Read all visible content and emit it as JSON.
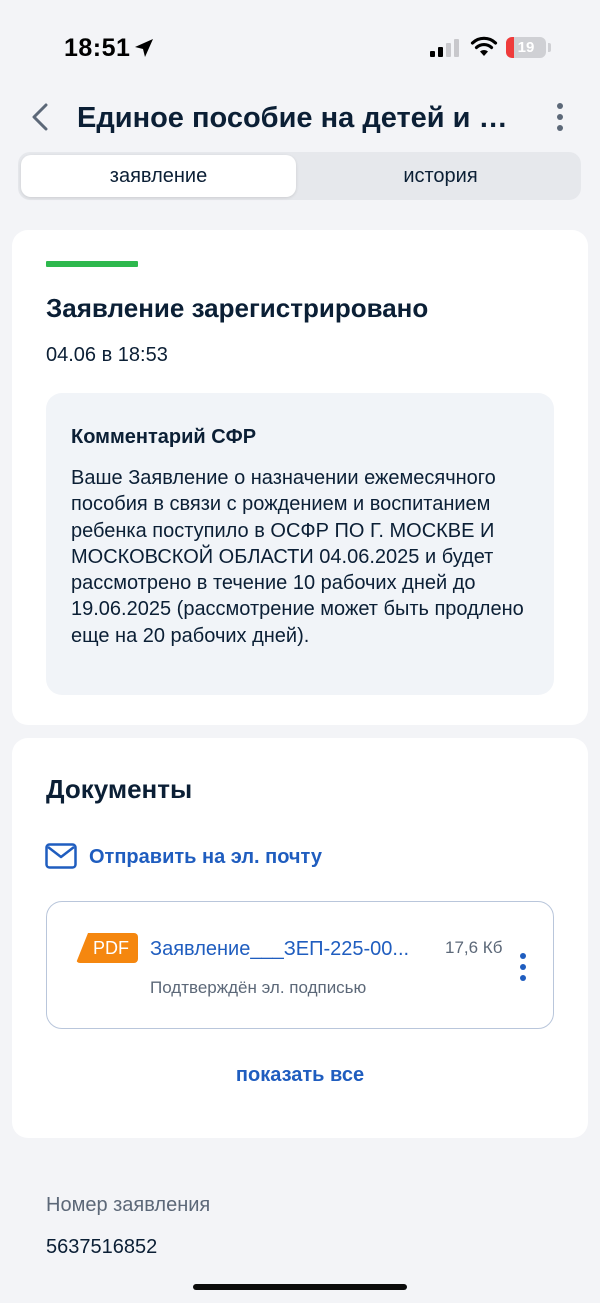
{
  "status_bar": {
    "time": "18:51",
    "battery": "19",
    "battery_level_percent": 19,
    "battery_color": "#ef3b3b",
    "icons": [
      "location-arrow-icon",
      "cellular-signal-icon",
      "wifi-icon",
      "battery-icon"
    ]
  },
  "header": {
    "title": "Единое пособие на детей и бе...",
    "icons": [
      "chevron-left-icon",
      "more-vertical-icon"
    ]
  },
  "tabs": [
    {
      "label": "заявление",
      "active": true
    },
    {
      "label": "история",
      "active": false
    }
  ],
  "status_card": {
    "title": "Заявление зарегистрировано",
    "date": "04.06 в 18:53",
    "progress_color": "#2db84d",
    "comment": {
      "heading": "Комментарий СФР",
      "text": "Ваше Заявление о назначении ежемесячного пособия в связи с рождением и воспитанием ребенка поступило в ОСФР ПО Г. МОСКВЕ И МОСКОВСКОЙ ОБЛАСТИ 04.06.2025 и будет рассмотрено в течение 10 рабочих дней до 19.06.2025 (рассмотрение может быть продлено еще на 20 рабочих дней)."
    }
  },
  "documents": {
    "title": "Документы",
    "email_link": "Отправить на эл. почту",
    "items": [
      {
        "badge": "PDF",
        "name": "Заявление___ЗЕП-225-00...",
        "size": "17,6 Кб",
        "signature": "Подтверждён эл. подписью"
      }
    ],
    "show_all": "показать все",
    "accent_color": "#1f5dbf",
    "badge_color": "#f5870f"
  },
  "application": {
    "number_label": "Номер заявления",
    "number_value": "5637516852"
  }
}
